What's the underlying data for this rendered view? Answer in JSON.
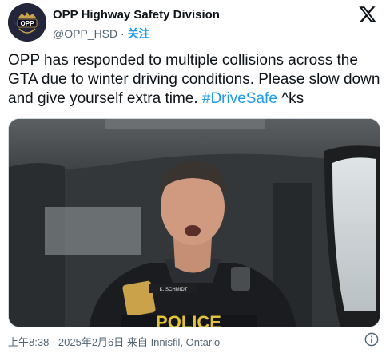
{
  "account": {
    "name": "OPP Highway Safety Division",
    "handle": "@OPP_HSD",
    "separator": "·",
    "follow_label": "关注",
    "avatar_text": "OPP"
  },
  "icons": {
    "brand": "x-logo-icon",
    "info": "info-icon"
  },
  "tweet": {
    "text_before": "OPP has responded to multiple collisions across the GTA due to winter driving conditions. Please slow down and give yourself extra time. ",
    "hashtag": "#DriveSafe",
    "text_after": " ^ks"
  },
  "media": {
    "name_tag": "K. SCHMIDT",
    "vest_text": "POLICE"
  },
  "meta": {
    "time": "上午8:38",
    "separator": "·",
    "date": "2025年2月6日",
    "source_prefix": "来自",
    "location": "Innisfil, Ontario"
  },
  "colors": {
    "accent": "#1d9bf0",
    "text": "#0f1419",
    "muted": "#536471"
  }
}
